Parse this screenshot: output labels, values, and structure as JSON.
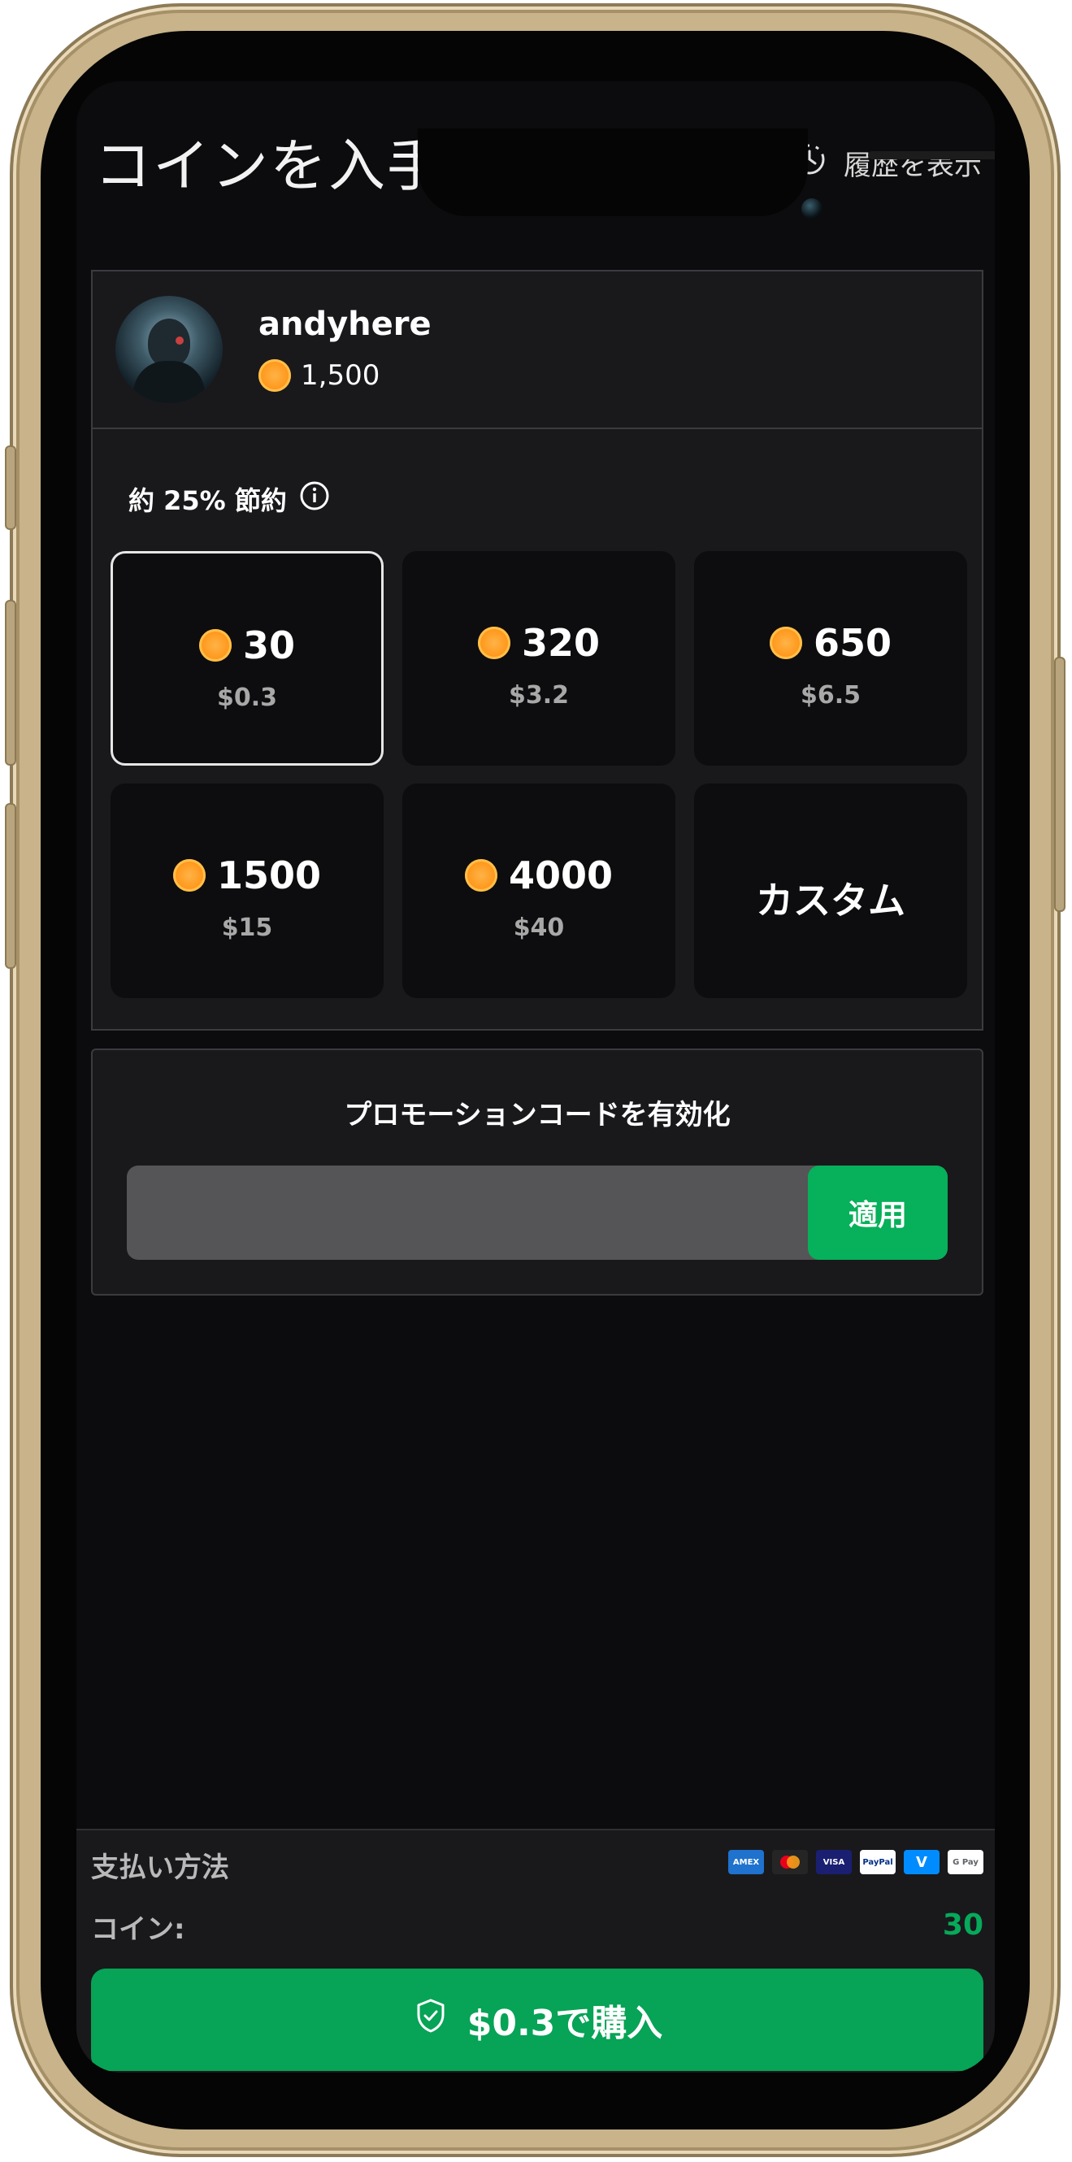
{
  "header": {
    "title": "コインを入手",
    "history_label": "履歴を表示",
    "history_icon": "history-clock-icon"
  },
  "user": {
    "name": "andyhere",
    "balance": "1,500",
    "coin_icon": "coin-icon"
  },
  "packs": {
    "savings_label": "約 25% 節約",
    "info_icon": "info-icon",
    "items": [
      {
        "coins": "30",
        "price": "$0.3",
        "selected": true
      },
      {
        "coins": "320",
        "price": "$3.2",
        "selected": false
      },
      {
        "coins": "650",
        "price": "$6.5",
        "selected": false
      },
      {
        "coins": "1500",
        "price": "$15",
        "selected": false
      },
      {
        "coins": "4000",
        "price": "$40",
        "selected": false
      }
    ],
    "custom_label": "カスタム"
  },
  "promo": {
    "title": "プロモーションコードを有効化",
    "input_value": "",
    "apply_label": "適用"
  },
  "payment": {
    "label": "支払い方法",
    "methods": [
      "amex",
      "mastercard",
      "visa",
      "paypal",
      "venmo",
      "google-pay"
    ],
    "coins_label": "コイン:",
    "coins_value": "30",
    "buy_label": "$0.3で購入",
    "buy_icon": "shield-check-icon"
  },
  "colors": {
    "accent_green": "#07a356",
    "coin_orange": "#ff9a1f",
    "background": "#0c0c0e",
    "card": "#19191c"
  }
}
